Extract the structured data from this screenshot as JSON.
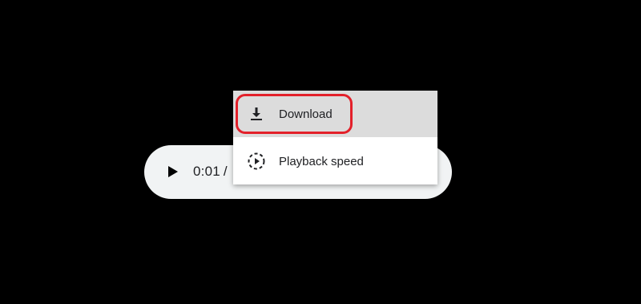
{
  "player": {
    "current_time": "0:01",
    "separator": "/",
    "play_icon": "play-icon",
    "more_icon": "more-options-icon"
  },
  "menu": {
    "items": [
      {
        "label": "Download",
        "icon": "download-icon",
        "highlighted": true
      },
      {
        "label": "Playback speed",
        "icon": "playback-speed-icon",
        "highlighted": false
      }
    ]
  },
  "colors": {
    "background": "#000000",
    "player_bg": "#f1f3f4",
    "menu_hover": "#dcdcdc",
    "highlight_outline": "#e3202a"
  }
}
